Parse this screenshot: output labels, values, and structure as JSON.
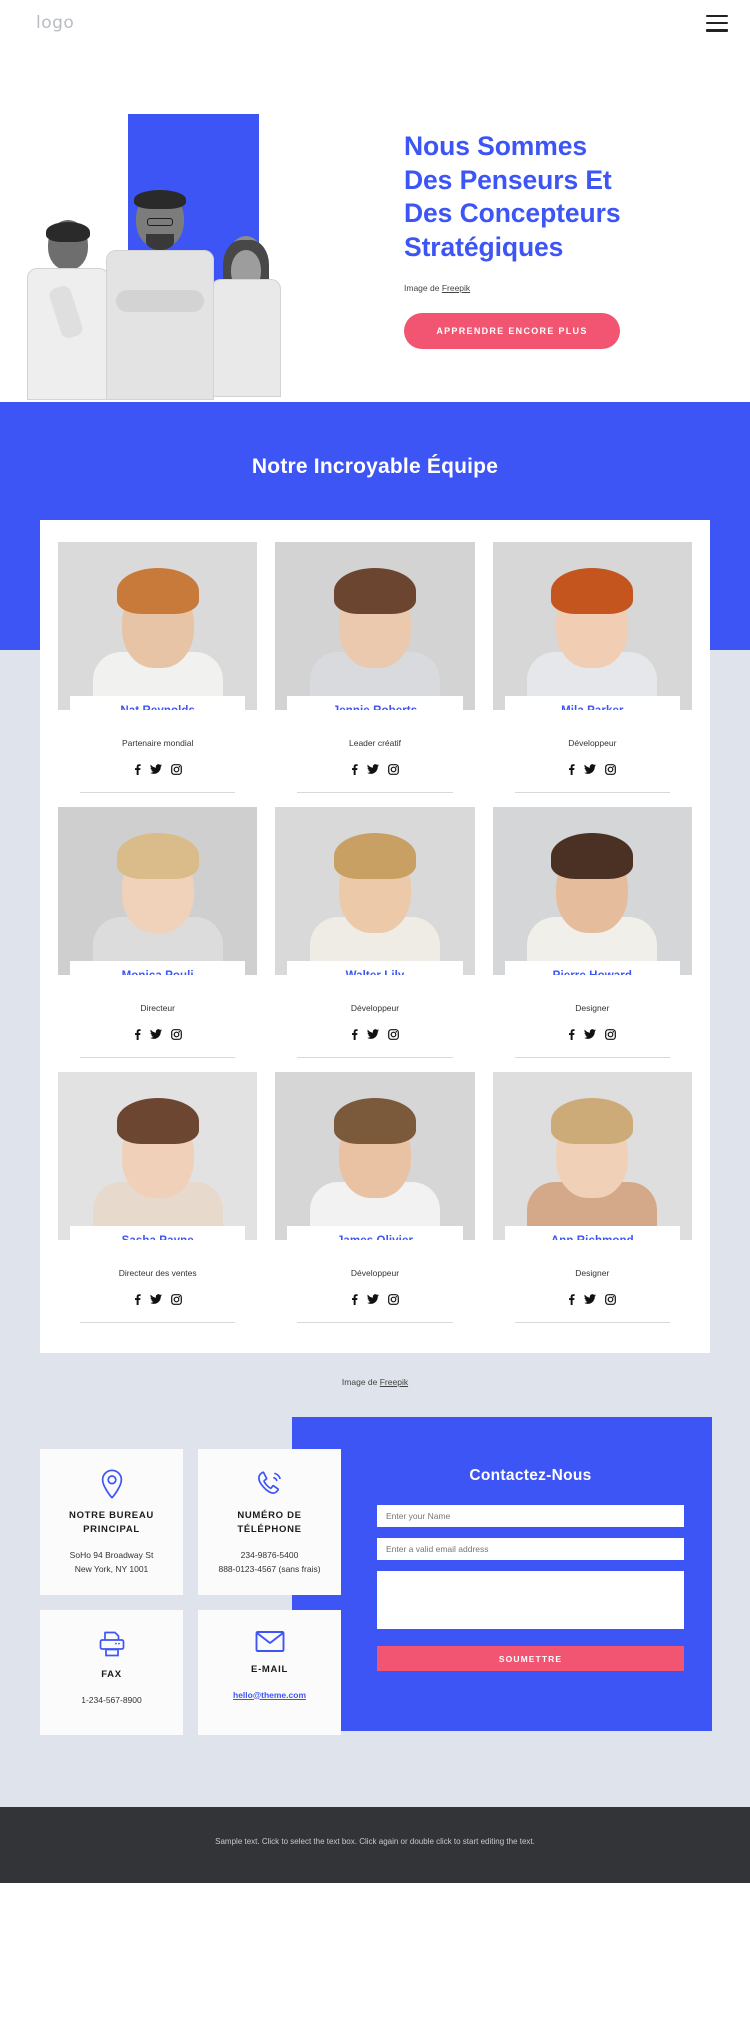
{
  "header": {
    "logo": "logo",
    "menu_icon": "hamburger-icon"
  },
  "hero": {
    "title_lines": [
      "Nous Sommes",
      "Des Penseurs Et",
      "Des Concepteurs",
      "Stratégiques"
    ],
    "title": "Nous Sommes Des Penseurs Et Des Concepteurs Stratégiques",
    "credit_prefix": "Image de ",
    "credit_link": "Freepik",
    "cta_label": "APPRENDRE ENCORE PLUS",
    "accent_blue": "#3d55f5",
    "accent_pink": "#f25571"
  },
  "team": {
    "heading": "Notre Incroyable Équipe",
    "credit_prefix": "Image de ",
    "credit_link": "Freepik",
    "social": [
      "f",
      "twitter-icon",
      "instagram-icon"
    ],
    "members": [
      {
        "name": "Nat Reynolds",
        "role": "Partenaire mondial",
        "hair": "#c77a3a",
        "skin": "#e8c4a6",
        "shirt": "#f1f1f0",
        "bg": "#dadada"
      },
      {
        "name": "Jennie Roberts",
        "role": "Leader créatif",
        "hair": "#6b4530",
        "skin": "#eac9ae",
        "shirt": "#d9dade",
        "bg": "#d3d3d4"
      },
      {
        "name": "Mila Parker",
        "role": "Développeur",
        "hair": "#c5551f",
        "skin": "#f0cdb3",
        "shirt": "#e6e7ea",
        "bg": "#d7d7d8"
      },
      {
        "name": "Monica Pouli",
        "role": "Directeur",
        "hair": "#d9bc8a",
        "skin": "#f0d2bb",
        "shirt": "#dcdcdd",
        "bg": "#cfcfd0"
      },
      {
        "name": "Walter Lily",
        "role": "Développeur",
        "hair": "#c9a063",
        "skin": "#ecc9a8",
        "shirt": "#efece5",
        "bg": "#d9d9d9"
      },
      {
        "name": "Pierre Howard",
        "role": "Designer",
        "hair": "#4a3123",
        "skin": "#e6bd9c",
        "shirt": "#f0efea",
        "bg": "#d5d6d7"
      },
      {
        "name": "Sasha Payne",
        "role": "Directeur des ventes",
        "hair": "#6d4632",
        "skin": "#f0d0b8",
        "shirt": "#e7d9cb",
        "bg": "#e2e2e2"
      },
      {
        "name": "James Olivier",
        "role": "Développeur",
        "hair": "#7a5a3b",
        "skin": "#e8c2a2",
        "shirt": "#f2f2f2",
        "bg": "#d6d6d6"
      },
      {
        "name": "Ann Richmond",
        "role": "Designer",
        "hair": "#cdab78",
        "skin": "#f0d0b6",
        "shirt": "#d4a98a",
        "bg": "#dededf"
      }
    ]
  },
  "contact": {
    "cards": [
      {
        "icon": "location-pin-icon",
        "title": "NOTRE BUREAU PRINCIPAL",
        "lines": [
          "SoHo 94 Broadway St",
          "New York, NY 1001"
        ],
        "link": null
      },
      {
        "icon": "phone-call-icon",
        "title": "NUMÉRO DE TÉLÉPHONE",
        "lines": [
          "234-9876-5400",
          "888-0123-4567 (sans frais)"
        ],
        "link": null
      },
      {
        "icon": "printer-icon",
        "title": "FAX",
        "lines": [
          "1-234-567-8900"
        ],
        "link": null
      },
      {
        "icon": "envelope-icon",
        "title": "E-MAIL",
        "lines": [],
        "link": "hello@theme.com"
      }
    ],
    "form": {
      "title": "Contactez-Nous",
      "name_placeholder": "Enter your Name",
      "name_value": "",
      "email_placeholder": "Enter a valid email address",
      "email_value": "",
      "message_placeholder": "",
      "message_value": "",
      "submit_label": "SOUMETTRE"
    }
  },
  "footer": {
    "text": "Sample text. Click to select the text box. Click again or double click to start editing the text."
  }
}
